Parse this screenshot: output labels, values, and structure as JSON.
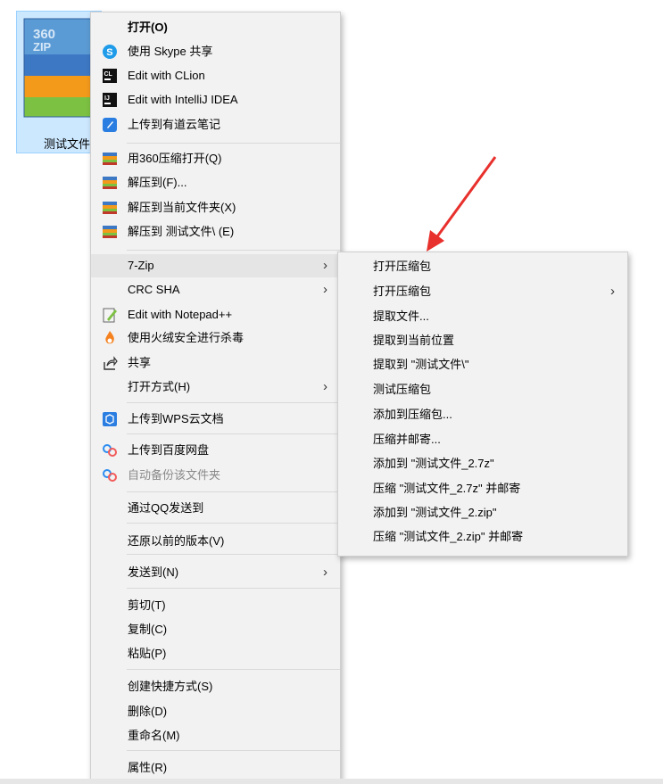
{
  "desktop": {
    "file_label": "测试文件",
    "icon_text": "360\nZIP"
  },
  "main_menu": [
    {
      "label": "打开(O)",
      "icon": "none",
      "bold": true,
      "submenu": false
    },
    {
      "label": "使用 Skype 共享",
      "icon": "skype-icon",
      "submenu": false
    },
    {
      "label": "Edit with CLion",
      "icon": "clion-icon",
      "submenu": false
    },
    {
      "label": "Edit with IntelliJ IDEA",
      "icon": "intellij-icon",
      "submenu": false
    },
    {
      "label": "上传到有道云笔记",
      "icon": "youdao-note-icon",
      "submenu": false
    },
    {
      "label": "用360压缩打开(Q)",
      "icon": "360zip-icon",
      "submenu": false
    },
    {
      "label": "解压到(F)...",
      "icon": "360zip-icon",
      "submenu": false
    },
    {
      "label": "解压到当前文件夹(X)",
      "icon": "360zip-icon",
      "submenu": false
    },
    {
      "label": "解压到 测试文件\\ (E)",
      "icon": "360zip-icon",
      "submenu": false
    },
    {
      "label": "7-Zip",
      "icon": "none",
      "submenu": true,
      "highlighted": true
    },
    {
      "label": "CRC SHA",
      "icon": "none",
      "submenu": true
    },
    {
      "label": "Edit with Notepad++",
      "icon": "notepadpp-icon",
      "submenu": false
    },
    {
      "label": "使用火绒安全进行杀毒",
      "icon": "huorong-icon",
      "submenu": false
    },
    {
      "label": "共享",
      "icon": "share-icon",
      "submenu": false
    },
    {
      "label": "打开方式(H)",
      "icon": "none",
      "submenu": true
    },
    {
      "label": "上传到WPS云文档",
      "icon": "wps-cloud-icon",
      "submenu": false
    },
    {
      "label": "上传到百度网盘",
      "icon": "baidu-netdisk-icon",
      "submenu": false
    },
    {
      "label": "自动备份该文件夹",
      "icon": "baidu-netdisk-icon",
      "submenu": false,
      "disabled": true
    },
    {
      "label": "通过QQ发送到",
      "icon": "none",
      "submenu": false
    },
    {
      "label": "还原以前的版本(V)",
      "icon": "none",
      "submenu": false
    },
    {
      "label": "发送到(N)",
      "icon": "none",
      "submenu": true
    },
    {
      "label": "剪切(T)",
      "icon": "none",
      "submenu": false
    },
    {
      "label": "复制(C)",
      "icon": "none",
      "submenu": false
    },
    {
      "label": "粘贴(P)",
      "icon": "none",
      "submenu": false
    },
    {
      "label": "创建快捷方式(S)",
      "icon": "none",
      "submenu": false
    },
    {
      "label": "删除(D)",
      "icon": "none",
      "submenu": false
    },
    {
      "label": "重命名(M)",
      "icon": "none",
      "submenu": false
    },
    {
      "label": "属性(R)",
      "icon": "none",
      "submenu": false
    }
  ],
  "sub_menu": [
    {
      "label": "打开压缩包",
      "submenu": false
    },
    {
      "label": "打开压缩包",
      "submenu": true
    },
    {
      "label": "提取文件...",
      "submenu": false
    },
    {
      "label": "提取到当前位置",
      "submenu": false
    },
    {
      "label": "提取到 \"测试文件\\\"",
      "submenu": false
    },
    {
      "label": "测试压缩包",
      "submenu": false
    },
    {
      "label": "添加到压缩包...",
      "submenu": false
    },
    {
      "label": "压缩并邮寄...",
      "submenu": false
    },
    {
      "label": "添加到 \"测试文件_2.7z\"",
      "submenu": false
    },
    {
      "label": "压缩 \"测试文件_2.7z\" 并邮寄",
      "submenu": false
    },
    {
      "label": "添加到 \"测试文件_2.zip\"",
      "submenu": false
    },
    {
      "label": "压缩 \"测试文件_2.zip\" 并邮寄",
      "submenu": false
    }
  ],
  "colors": {
    "menu_bg": "#f2f2f2",
    "selection": "#cce8ff",
    "arrow": "#e8302c"
  }
}
